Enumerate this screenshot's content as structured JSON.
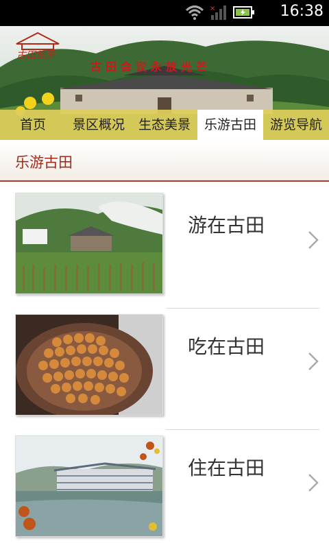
{
  "status": {
    "time": "16:38"
  },
  "banner": {
    "logo_text": "古田旅游",
    "caption": "古田会议永放光芒"
  },
  "nav": {
    "items": [
      {
        "label": "首页"
      },
      {
        "label": "景区概况"
      },
      {
        "label": "生态美景"
      },
      {
        "label": "乐游古田"
      },
      {
        "label": "游览导航"
      }
    ],
    "active_index": 3
  },
  "section": {
    "title": "乐游古田"
  },
  "list": [
    {
      "label": "游在古田",
      "icon": "village-photo"
    },
    {
      "label": "吃在古田",
      "icon": "food-photo"
    },
    {
      "label": "住在古田",
      "icon": "hotel-photo"
    }
  ],
  "colors": {
    "accent": "#a32a1a",
    "nav_bg": "#decd5c",
    "divider": "#b23a2a"
  }
}
